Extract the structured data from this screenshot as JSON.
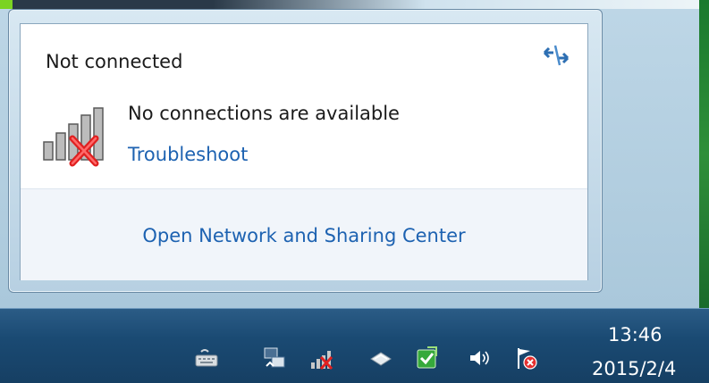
{
  "popup": {
    "title": "Not connected",
    "status": "No connections are available",
    "troubleshoot": "Troubleshoot",
    "open_center": "Open Network and Sharing Center"
  },
  "taskbar": {
    "time": "13:46",
    "date": "2015/2/4",
    "tray_icons": [
      "keyboard-icon",
      "network-sharing-icon",
      "network-disconnected-icon",
      "eject-icon",
      "security-check-icon",
      "speaker-icon",
      "action-center-flag-icon"
    ]
  },
  "colors": {
    "link": "#1d62b1",
    "taskbar": "#1a4a73",
    "panel_bottom": "#f1f5fa"
  }
}
